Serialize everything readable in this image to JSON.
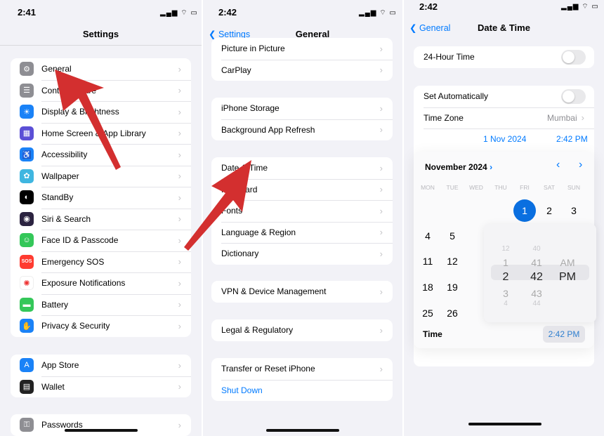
{
  "left": {
    "status_time": "2:41",
    "status_icons": "▂▄▆ ⌔ ▭",
    "title": "Settings",
    "groups": [
      [
        {
          "label": "General",
          "icon": "gear-icon",
          "color": "#8e8e93",
          "glyph": "⚙"
        },
        {
          "label": "Control Centre",
          "icon": "switches-icon",
          "color": "#8e8e93",
          "glyph": "☰"
        },
        {
          "label": "Display & Brightness",
          "icon": "sun-icon",
          "color": "#1a82f7",
          "glyph": "☀"
        },
        {
          "label": "Home Screen & App Library",
          "icon": "app-grid-icon",
          "color": "#5b4fd6",
          "glyph": "▦"
        },
        {
          "label": "Accessibility",
          "icon": "accessibility-icon",
          "color": "#1a82f7",
          "glyph": "♿"
        },
        {
          "label": "Wallpaper",
          "icon": "flower-icon",
          "color": "#3fb6e0",
          "glyph": "✿"
        },
        {
          "label": "StandBy",
          "icon": "standby-icon",
          "color": "#000000",
          "glyph": "◐"
        },
        {
          "label": "Siri & Search",
          "icon": "siri-icon",
          "color": "#2b2340",
          "glyph": "◉"
        },
        {
          "label": "Face ID & Passcode",
          "icon": "face-id-icon",
          "color": "#34c759",
          "glyph": "☺"
        },
        {
          "label": "Emergency SOS",
          "icon": "sos-icon",
          "color": "#ff3b30",
          "glyph": "SOS"
        },
        {
          "label": "Exposure Notifications",
          "icon": "exposure-icon",
          "color": "#ffffff",
          "glyph": "✺"
        },
        {
          "label": "Battery",
          "icon": "battery-icon",
          "color": "#34c759",
          "glyph": "▬"
        },
        {
          "label": "Privacy & Security",
          "icon": "hand-icon",
          "color": "#1a82f7",
          "glyph": "✋"
        }
      ],
      [
        {
          "label": "App Store",
          "icon": "app-store-icon",
          "color": "#1a82f7",
          "glyph": "A"
        },
        {
          "label": "Wallet",
          "icon": "wallet-icon",
          "color": "#222222",
          "glyph": "▤"
        }
      ],
      [
        {
          "label": "Passwords",
          "icon": "key-icon",
          "color": "#8e8e93",
          "glyph": "⚿"
        }
      ]
    ]
  },
  "middle": {
    "status_time": "2:42",
    "status_icons": "▂▄▆ ⌔ ▭",
    "back": "Settings",
    "title": "General",
    "groups": [
      [
        "Picture in Picture",
        "CarPlay"
      ],
      [
        "iPhone Storage",
        "Background App Refresh"
      ],
      [
        "Date & Time",
        "Keyboard",
        "Fonts",
        "Language & Region",
        "Dictionary"
      ],
      [
        "VPN & Device Management"
      ],
      [
        "Legal & Regulatory"
      ],
      [
        "Transfer or Reset iPhone"
      ]
    ],
    "shut_down": "Shut Down"
  },
  "right": {
    "status_time": "2:42",
    "status_icons": "▂▄▆ ⌔ ▭",
    "back": "General",
    "title": "Date & Time",
    "twenty_four_hour": "24-Hour Time",
    "set_auto": "Set Automatically",
    "time_zone": "Time Zone",
    "time_zone_value": "Mumbai",
    "date_value": "1 Nov 2024",
    "time_value": "2:42 PM",
    "calendar": {
      "month": "November 2024",
      "weekdays": [
        "MON",
        "TUE",
        "WED",
        "THU",
        "FRI",
        "SAT",
        "SUN"
      ],
      "days": [
        "1",
        "2",
        "3",
        "4",
        "5",
        "11",
        "12",
        "18",
        "19",
        "25",
        "26"
      ],
      "selected": "1"
    },
    "picker": {
      "hours": [
        "12",
        "1",
        "2",
        "3",
        "4"
      ],
      "minutes": [
        "40",
        "41",
        "42",
        "43",
        "44"
      ],
      "ampm": [
        "AM",
        "PM"
      ]
    },
    "time_label": "Time",
    "time_button": "2:42 PM"
  },
  "accent": "#007aff",
  "arrow_color": "#d32f2f"
}
